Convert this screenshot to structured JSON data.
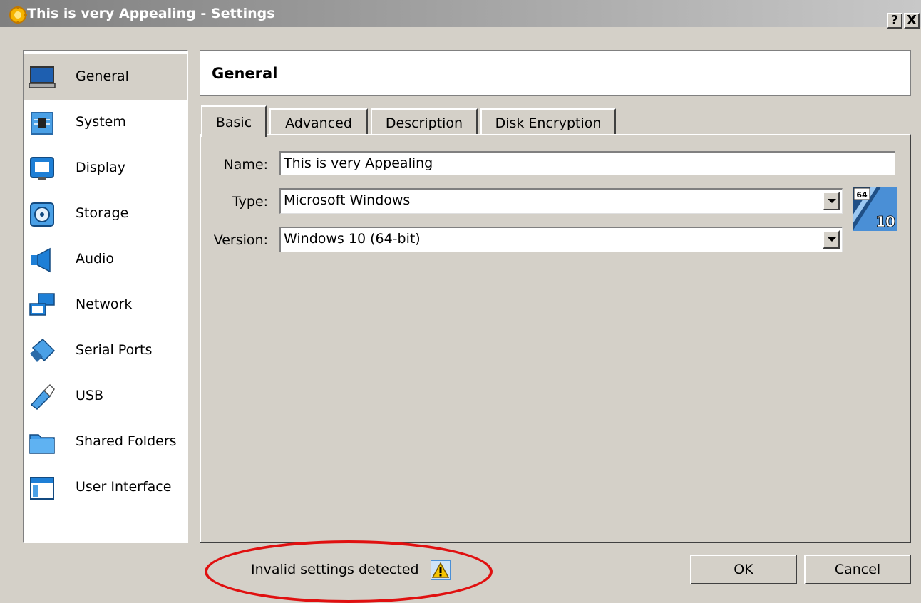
{
  "window": {
    "title": "This is very Appealing - Settings",
    "help_label": "?",
    "close_label": "X"
  },
  "sidebar": {
    "items": [
      {
        "label": "General",
        "icon": "monitor-laptop-icon",
        "active": true
      },
      {
        "label": "System",
        "icon": "chip-icon"
      },
      {
        "label": "Display",
        "icon": "display-icon"
      },
      {
        "label": "Storage",
        "icon": "disk-icon"
      },
      {
        "label": "Audio",
        "icon": "speaker-icon"
      },
      {
        "label": "Network",
        "icon": "network-icon"
      },
      {
        "label": "Serial Ports",
        "icon": "serial-port-icon"
      },
      {
        "label": "USB",
        "icon": "usb-icon"
      },
      {
        "label": "Shared Folders",
        "icon": "folder-icon"
      },
      {
        "label": "User Interface",
        "icon": "window-ui-icon"
      }
    ]
  },
  "header": {
    "title": "General"
  },
  "tabs": [
    {
      "label": "Basic",
      "active": true
    },
    {
      "label": "Advanced"
    },
    {
      "label": "Description"
    },
    {
      "label": "Disk Encryption"
    }
  ],
  "form": {
    "name_label": "Name:",
    "name_value": "This is very Appealing",
    "type_label": "Type:",
    "type_value": "Microsoft Windows",
    "version_label": "Version:",
    "version_value": "Windows 10 (64-bit)",
    "os_icon": "windows-10-64-icon",
    "os_badge_top": "64",
    "os_badge_bottom": "10"
  },
  "footer": {
    "status_text": "Invalid settings detected",
    "status_icon": "warning-icon",
    "ok_label": "OK",
    "cancel_label": "Cancel"
  },
  "colors": {
    "dialog_bg": "#d4d0c8",
    "highlight_ring": "#e01010",
    "icon_blue": "#1e7fd6"
  }
}
